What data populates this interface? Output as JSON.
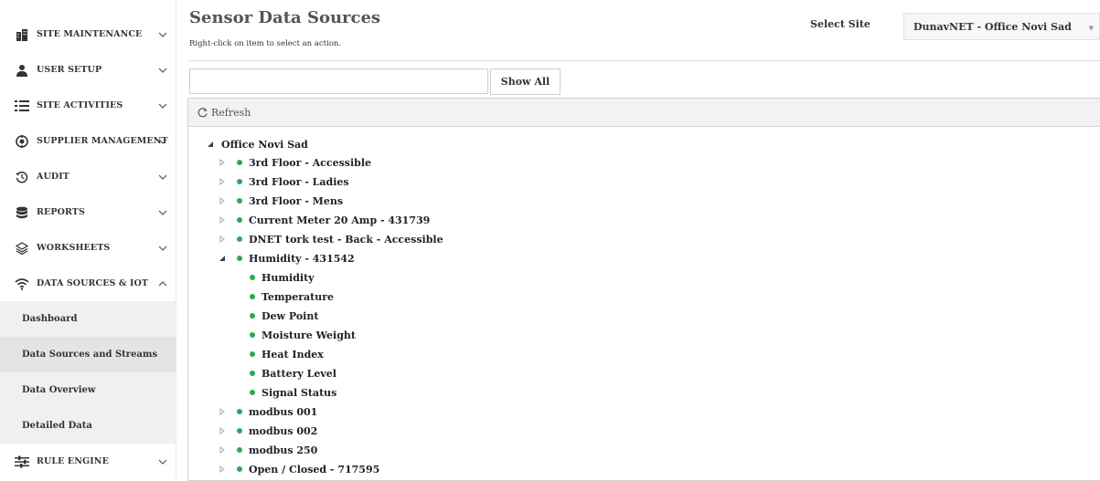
{
  "sidebar": {
    "items": [
      {
        "label": "SITE MAINTENANCE",
        "icon": "building-icon",
        "chevron": "down"
      },
      {
        "label": "USER SETUP",
        "icon": "user-icon",
        "chevron": "down"
      },
      {
        "label": "SITE ACTIVITIES",
        "icon": "list-icon",
        "chevron": "down"
      },
      {
        "label": "SUPPLIER MANAGEMENT",
        "icon": "supplier-icon",
        "chevron": "down"
      },
      {
        "label": "AUDIT",
        "icon": "history-icon",
        "chevron": "down"
      },
      {
        "label": "REPORTS",
        "icon": "database-icon",
        "chevron": "down"
      },
      {
        "label": "WORKSHEETS",
        "icon": "layers-icon",
        "chevron": "down"
      },
      {
        "label": "DATA SOURCES & IOT",
        "icon": "wifi-icon",
        "chevron": "up"
      },
      {
        "label": "RULE ENGINE",
        "icon": "sliders-icon",
        "chevron": "down"
      }
    ],
    "subitems": [
      {
        "label": "Dashboard"
      },
      {
        "label": "Data Sources and Streams"
      },
      {
        "label": "Data Overview"
      },
      {
        "label": "Detailed Data"
      }
    ]
  },
  "header": {
    "title": "Sensor Data Sources",
    "hint": "Right-click on item to select an action.",
    "site_label": "Select Site",
    "site_value": "DunavNET - Office Novi Sad"
  },
  "filter": {
    "value": "",
    "show_all_label": "Show All"
  },
  "toolbar": {
    "refresh_label": "Refresh"
  },
  "tree": {
    "root": "Office Novi Sad",
    "nodes": [
      "3rd Floor - Accessible",
      "3rd Floor - Ladies",
      "3rd Floor - Mens",
      "Current Meter 20 Amp - 431739",
      "DNET tork test - Back - Accessible",
      "Humidity - 431542",
      "modbus 001",
      "modbus 002",
      "modbus 250",
      "Open / Closed - 717595"
    ],
    "children": [
      "Humidity",
      "Temperature",
      "Dew Point",
      "Moisture Weight",
      "Heat Index",
      "Battery Level",
      "Signal Status"
    ]
  },
  "colors": {
    "status_dot": "#2fa84f",
    "active_bg": "#e4e4e4",
    "sub_bg": "#f0f0f0"
  }
}
